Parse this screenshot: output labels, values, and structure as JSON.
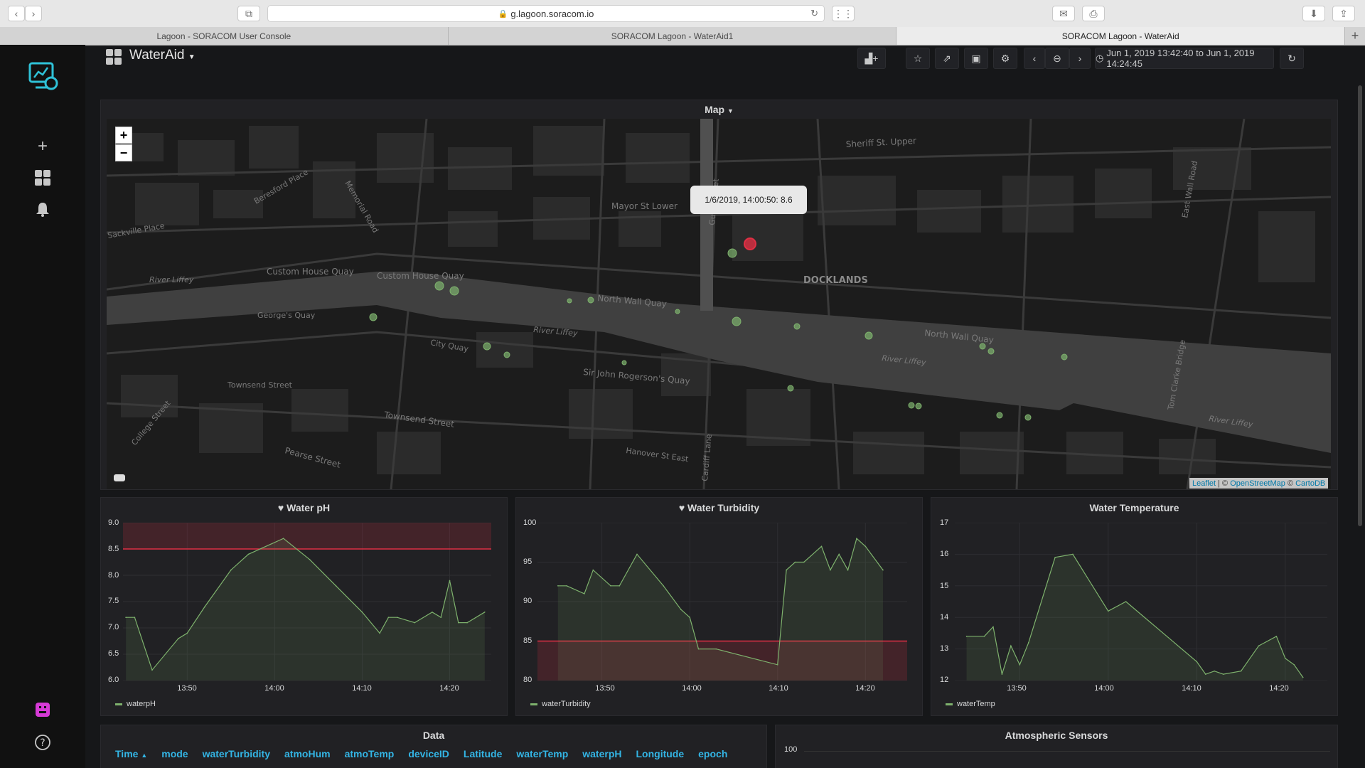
{
  "browser": {
    "url": "g.lagoon.soracom.io",
    "tabs": [
      {
        "label": "Lagoon - SORACOM User Console",
        "active": false
      },
      {
        "label": "SORACOM Lagoon - WaterAid1",
        "active": false
      },
      {
        "label": "SORACOM Lagoon - WaterAid",
        "active": true
      }
    ]
  },
  "dashboard": {
    "title": "WaterAid",
    "time_range": "Jun 1, 2019 13:42:40 to Jun 1, 2019 14:24:45"
  },
  "map": {
    "title": "Map",
    "tooltip": "1/6/2019, 14:00:50: 8.6",
    "attribution": {
      "leaflet": "Leaflet",
      "sep1": "| ©",
      "osm": "OpenStreetMap",
      "sep2": "©",
      "carto": "CartoDB"
    },
    "labels": {
      "docklands": "DOCKLANDS",
      "custom_house_quay": "Custom House Quay",
      "north_wall_quay": "North Wall Quay",
      "sir_john_rogersons_quay": "Sir John Rogerson's Quay",
      "city_quay": "City Quay",
      "georges_quay": "George's Quay",
      "river_liffey": "River Liffey",
      "townsend_street": "Townsend Street",
      "pearse_street": "Pearse Street",
      "mayor_st_lower": "Mayor St Lower",
      "sheriff_st_upper": "Sheriff St. Upper",
      "hanover_st_east": "Hanover St East",
      "east_wall_road": "East Wall Road",
      "tom_clarke_bridge": "Tom Clarke Bridge",
      "memorial_road": "Memorial Road",
      "beresford_place": "Beresford Place",
      "guild_street": "Guild Street",
      "cardiff_lane": "Cardiff Lane",
      "college_street": "College Street",
      "sackville_place": "Sackville Place"
    }
  },
  "panels": {
    "ph": {
      "title": "Water pH",
      "legend": "waterpH",
      "yticks": [
        "9.0",
        "8.5",
        "8.0",
        "7.5",
        "7.0",
        "6.5",
        "6.0"
      ],
      "xticks": [
        "13:50",
        "14:00",
        "14:10",
        "14:20"
      ]
    },
    "turbidity": {
      "title": "Water Turbidity",
      "legend": "waterTurbidity",
      "yticks": [
        "100",
        "95",
        "90",
        "85",
        "80"
      ],
      "xticks": [
        "13:50",
        "14:00",
        "14:10",
        "14:20"
      ]
    },
    "temp": {
      "title": "Water Temperature",
      "legend": "waterTemp",
      "yticks": [
        "17",
        "16",
        "15",
        "14",
        "13",
        "12"
      ],
      "xticks": [
        "13:50",
        "14:00",
        "14:10",
        "14:20"
      ]
    },
    "data": {
      "title": "Data",
      "columns": [
        "Time",
        "mode",
        "waterTurbidity",
        "atmoHum",
        "atmoTemp",
        "deviceID",
        "Latitude",
        "waterTemp",
        "waterpH",
        "Longitude",
        "epoch"
      ]
    },
    "atmo": {
      "title": "Atmospheric Sensors",
      "ytick_top": "100"
    }
  },
  "chart_data": [
    {
      "type": "area",
      "title": "Water pH",
      "series": [
        {
          "name": "waterpH",
          "x": [
            "13:43",
            "13:44",
            "13:46",
            "13:49",
            "13:50",
            "13:52",
            "13:55",
            "13:57",
            "14:01",
            "14:04",
            "14:07",
            "14:10",
            "14:12",
            "14:13",
            "14:14",
            "14:16",
            "14:18",
            "14:19",
            "14:20",
            "14:21",
            "14:22",
            "14:24"
          ],
          "values": [
            7.2,
            7.2,
            6.2,
            6.8,
            6.9,
            7.4,
            8.1,
            8.4,
            8.7,
            8.3,
            7.8,
            7.3,
            6.9,
            7.2,
            7.2,
            7.1,
            7.3,
            7.2,
            7.9,
            7.1,
            7.1,
            7.3
          ]
        }
      ],
      "ylim": [
        6.0,
        9.0
      ],
      "threshold": 8.5,
      "colors": {
        "line": "#7eb26d",
        "threshold": "#e02f44"
      }
    },
    {
      "type": "area",
      "title": "Water Turbidity",
      "series": [
        {
          "name": "waterTurbidity",
          "x": [
            "13:45",
            "13:46",
            "13:48",
            "13:49",
            "13:51",
            "13:52",
            "13:54",
            "13:57",
            "13:59",
            "14:00",
            "14:01",
            "14:03",
            "14:10",
            "14:11",
            "14:12",
            "14:13",
            "14:15",
            "14:16",
            "14:17",
            "14:18",
            "14:19",
            "14:20",
            "14:22"
          ],
          "values": [
            92,
            92,
            91,
            94,
            92,
            92,
            96,
            92,
            89,
            88,
            84,
            84,
            82,
            94,
            95,
            95,
            97,
            94,
            96,
            94,
            98,
            97,
            94
          ]
        }
      ],
      "ylim": [
        80,
        100
      ],
      "threshold": 85,
      "colors": {
        "line": "#7eb26d",
        "threshold": "#e02f44"
      }
    },
    {
      "type": "area",
      "title": "Water Temperature",
      "series": [
        {
          "name": "waterTemp",
          "x": [
            "13:44",
            "13:46",
            "13:47",
            "13:48",
            "13:49",
            "13:50",
            "13:51",
            "13:54",
            "13:56",
            "14:00",
            "14:02",
            "14:10",
            "14:11",
            "14:12",
            "14:13",
            "14:15",
            "14:17",
            "14:19",
            "14:20",
            "14:21",
            "14:22"
          ],
          "values": [
            13.4,
            13.4,
            13.7,
            12.2,
            13.1,
            12.5,
            13.2,
            15.9,
            16.0,
            14.2,
            14.5,
            12.6,
            12.2,
            12.3,
            12.2,
            12.3,
            13.1,
            13.4,
            12.7,
            12.5,
            12.1
          ]
        }
      ],
      "ylim": [
        12,
        17
      ],
      "colors": {
        "line": "#7eb26d"
      }
    }
  ]
}
